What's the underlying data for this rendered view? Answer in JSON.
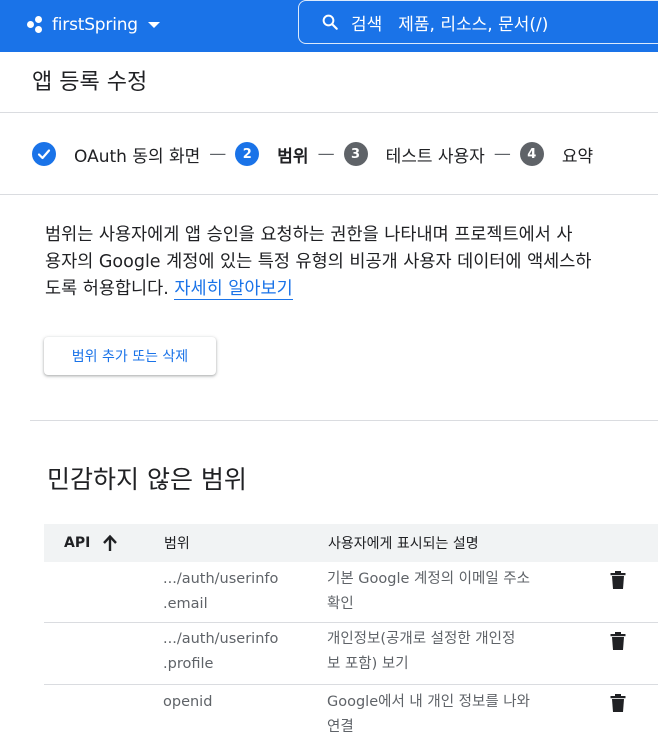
{
  "header": {
    "project_name": "firstSpring",
    "search_label": "검색",
    "search_placeholder": "제품, 리소스, 문서(/)"
  },
  "page_title": "앱 등록 수정",
  "stepper": {
    "steps": [
      {
        "label": "OAuth 동의 화면",
        "number": "",
        "state": "completed"
      },
      {
        "label": "범위",
        "number": "2",
        "state": "active"
      },
      {
        "label": "테스트 사용자",
        "number": "3",
        "state": "upcoming"
      },
      {
        "label": "요약",
        "number": "4",
        "state": "upcoming"
      }
    ],
    "separator": "—"
  },
  "scopes_intro": {
    "line1": "범위는 사용자에게 앱 승인을 요청하는 권한을 나타내며 프로젝트에서 사",
    "line2": "용자의 Google 계정에 있는 특정 유형의 비공개 사용자 데이터에 액세스하",
    "line3": "도록 허용합니다.",
    "learn_more": "자세히 알아보기"
  },
  "add_remove_button": "범위 추가 또는 삭제",
  "non_sensitive": {
    "title": "민감하지 않은 범위",
    "columns": {
      "api": "API",
      "scope": "범위",
      "description": "사용자에게 표시되는 설명"
    },
    "rows": [
      {
        "scope_1": ".../auth/userinfo",
        "scope_2": ".email",
        "desc_1": "기본 Google 계정의 이메일 주소",
        "desc_2": "확인"
      },
      {
        "scope_1": ".../auth/userinfo",
        "scope_2": ".profile",
        "desc_1": "개인정보(공개로 설정한 개인정",
        "desc_2": "보 포함) 보기"
      },
      {
        "scope_1": "openid",
        "scope_2": "",
        "desc_1": "Google에서 내 개인 정보를 나와",
        "desc_2": "연결"
      }
    ]
  },
  "colors": {
    "brand_blue": "#1a73e8",
    "step_gray": "#5f6368"
  }
}
